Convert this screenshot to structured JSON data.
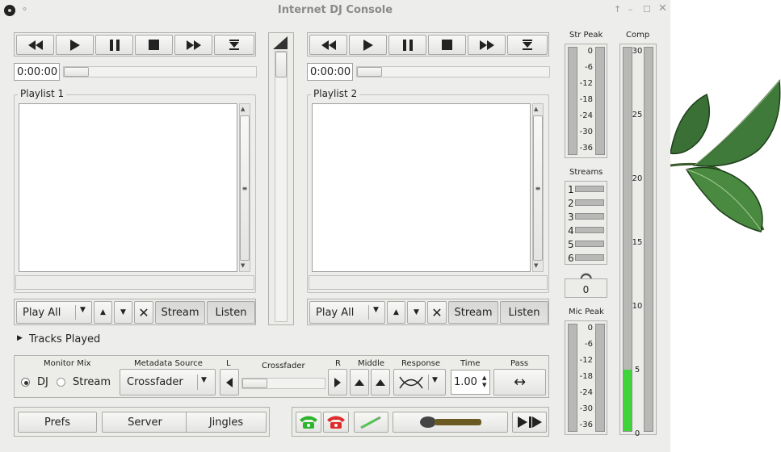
{
  "window": {
    "title": "Internet DJ Console"
  },
  "player1": {
    "time": "0:00:00",
    "playlist_title": "Playlist 1",
    "mode": "Play All",
    "stream_label": "Stream",
    "listen_label": "Listen"
  },
  "player2": {
    "time": "0:00:00",
    "playlist_title": "Playlist 2",
    "mode": "Play All",
    "stream_label": "Stream",
    "listen_label": "Listen"
  },
  "tracks_played": "Tracks Played",
  "mixer": {
    "monitor_mix_label": "Monitor Mix",
    "dj_label": "DJ",
    "stream_label": "Stream",
    "monitor_selected": "DJ",
    "metadata_source_label": "Metadata Source",
    "metadata_source_value": "Crossfader",
    "left_label": "L",
    "crossfader_label": "Crossfader",
    "right_label": "R",
    "middle_label": "Middle",
    "response_label": "Response",
    "time_label": "Time",
    "time_value": "1.00",
    "pass_label": "Pass",
    "crossfader_position": 0
  },
  "bottom": {
    "prefs": "Prefs",
    "server": "Server",
    "jingles": "Jingles"
  },
  "meters": {
    "str_peak_label": "Str Peak",
    "str_peak_ticks": [
      "0",
      "-6",
      "-12",
      "-18",
      "-24",
      "-30",
      "-36"
    ],
    "streams_label": "Streams",
    "streams": [
      "1",
      "2",
      "3",
      "4",
      "5",
      "6"
    ],
    "listen_count": "0",
    "mic_peak_label": "Mic Peak",
    "mic_peak_ticks": [
      "0",
      "-6",
      "-12",
      "-18",
      "-24",
      "-30",
      "-36"
    ],
    "comp_label": "Comp",
    "comp_ticks": [
      "30",
      "25",
      "20",
      "15",
      "10",
      "5",
      "0"
    ],
    "comp_level": 4.8
  },
  "colors": {
    "accent_green": "#3fd43a",
    "phone_red": "#e02b2b",
    "phone_green": "#2cb52c"
  }
}
